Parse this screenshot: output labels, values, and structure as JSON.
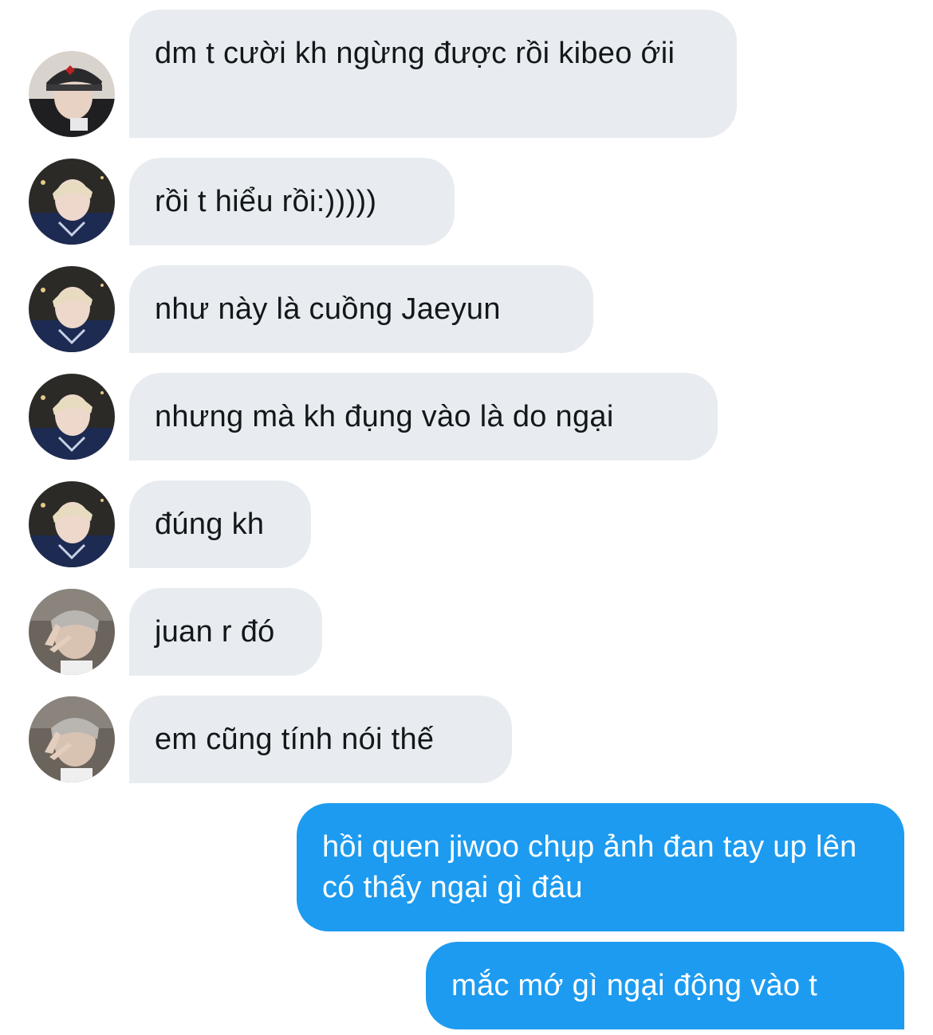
{
  "conversation": {
    "messages": [
      {
        "sender": "friend-1",
        "direction": "incoming",
        "text": "dm t cười kh ngừng được rồi kibeo ớii"
      },
      {
        "sender": "friend-2",
        "direction": "incoming",
        "text": "rồi t hiểu rồi:)))))"
      },
      {
        "sender": "friend-2",
        "direction": "incoming",
        "text": "như này là cuồng Jaeyun"
      },
      {
        "sender": "friend-2",
        "direction": "incoming",
        "text": "nhưng mà kh đụng vào là do ngại"
      },
      {
        "sender": "friend-2",
        "direction": "incoming",
        "text": "đúng kh"
      },
      {
        "sender": "friend-3",
        "direction": "incoming",
        "text": "juan r đó"
      },
      {
        "sender": "friend-3",
        "direction": "incoming",
        "text": "em cũng tính nói thế"
      },
      {
        "sender": "me",
        "direction": "outgoing",
        "text": "hồi quen jiwoo chụp ảnh đan tay up lên có thấy ngại gì đâu"
      },
      {
        "sender": "me",
        "direction": "outgoing",
        "text": "mắc mớ gì ngại động vào t"
      }
    ]
  },
  "colors": {
    "incoming_bubble": "#e8ecf0",
    "incoming_text": "#14171a",
    "outgoing_bubble": "#1d9bf0",
    "outgoing_text": "#ffffff",
    "background": "#ffffff"
  },
  "avatars": {
    "friend-1": "avatar-photo-cap",
    "friend-2": "avatar-photo-blond",
    "friend-3": "avatar-photo-hand-sign"
  }
}
